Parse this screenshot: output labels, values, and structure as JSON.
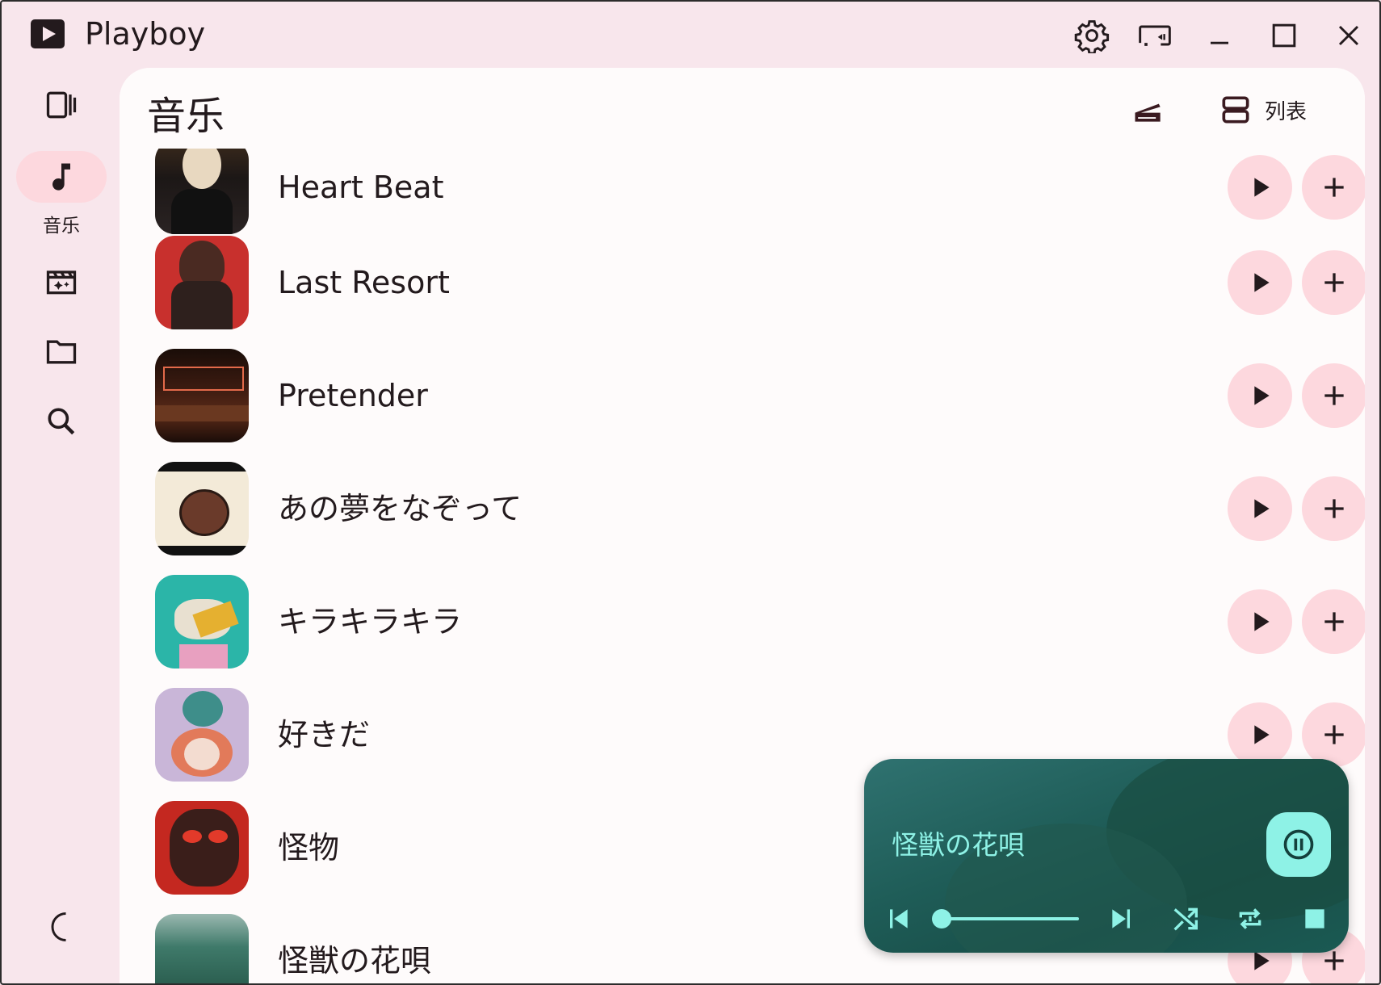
{
  "app": {
    "title": "Playboy"
  },
  "titlebar": {
    "icons": [
      "settings-icon",
      "cast-icon",
      "minimize-icon",
      "maximize-icon",
      "close-icon"
    ]
  },
  "sidebar": {
    "items": [
      {
        "icon": "video-library-icon",
        "label": ""
      },
      {
        "icon": "music-note-icon",
        "label": "音乐",
        "active": true
      },
      {
        "icon": "movie-icon",
        "label": ""
      },
      {
        "icon": "folder-icon",
        "label": ""
      },
      {
        "icon": "search-icon",
        "label": ""
      }
    ],
    "bottom_icon": "dark-mode-icon"
  },
  "main": {
    "title": "音乐",
    "view_label": "列表",
    "songs": [
      {
        "title": "Heart Beat"
      },
      {
        "title": "Last Resort"
      },
      {
        "title": "Pretender"
      },
      {
        "title": "あの夢をなぞって"
      },
      {
        "title": "キラキラキラ"
      },
      {
        "title": "好きだ"
      },
      {
        "title": "怪物"
      },
      {
        "title": "怪獣の花唄"
      }
    ]
  },
  "player": {
    "now_playing": "怪獣の花唄",
    "progress": 0.0,
    "accent": "#8ef2e6"
  },
  "colors": {
    "background": "#f8e6ec",
    "panel": "#fefbfb",
    "button": "#fdd8de",
    "text": "#231a1d"
  }
}
